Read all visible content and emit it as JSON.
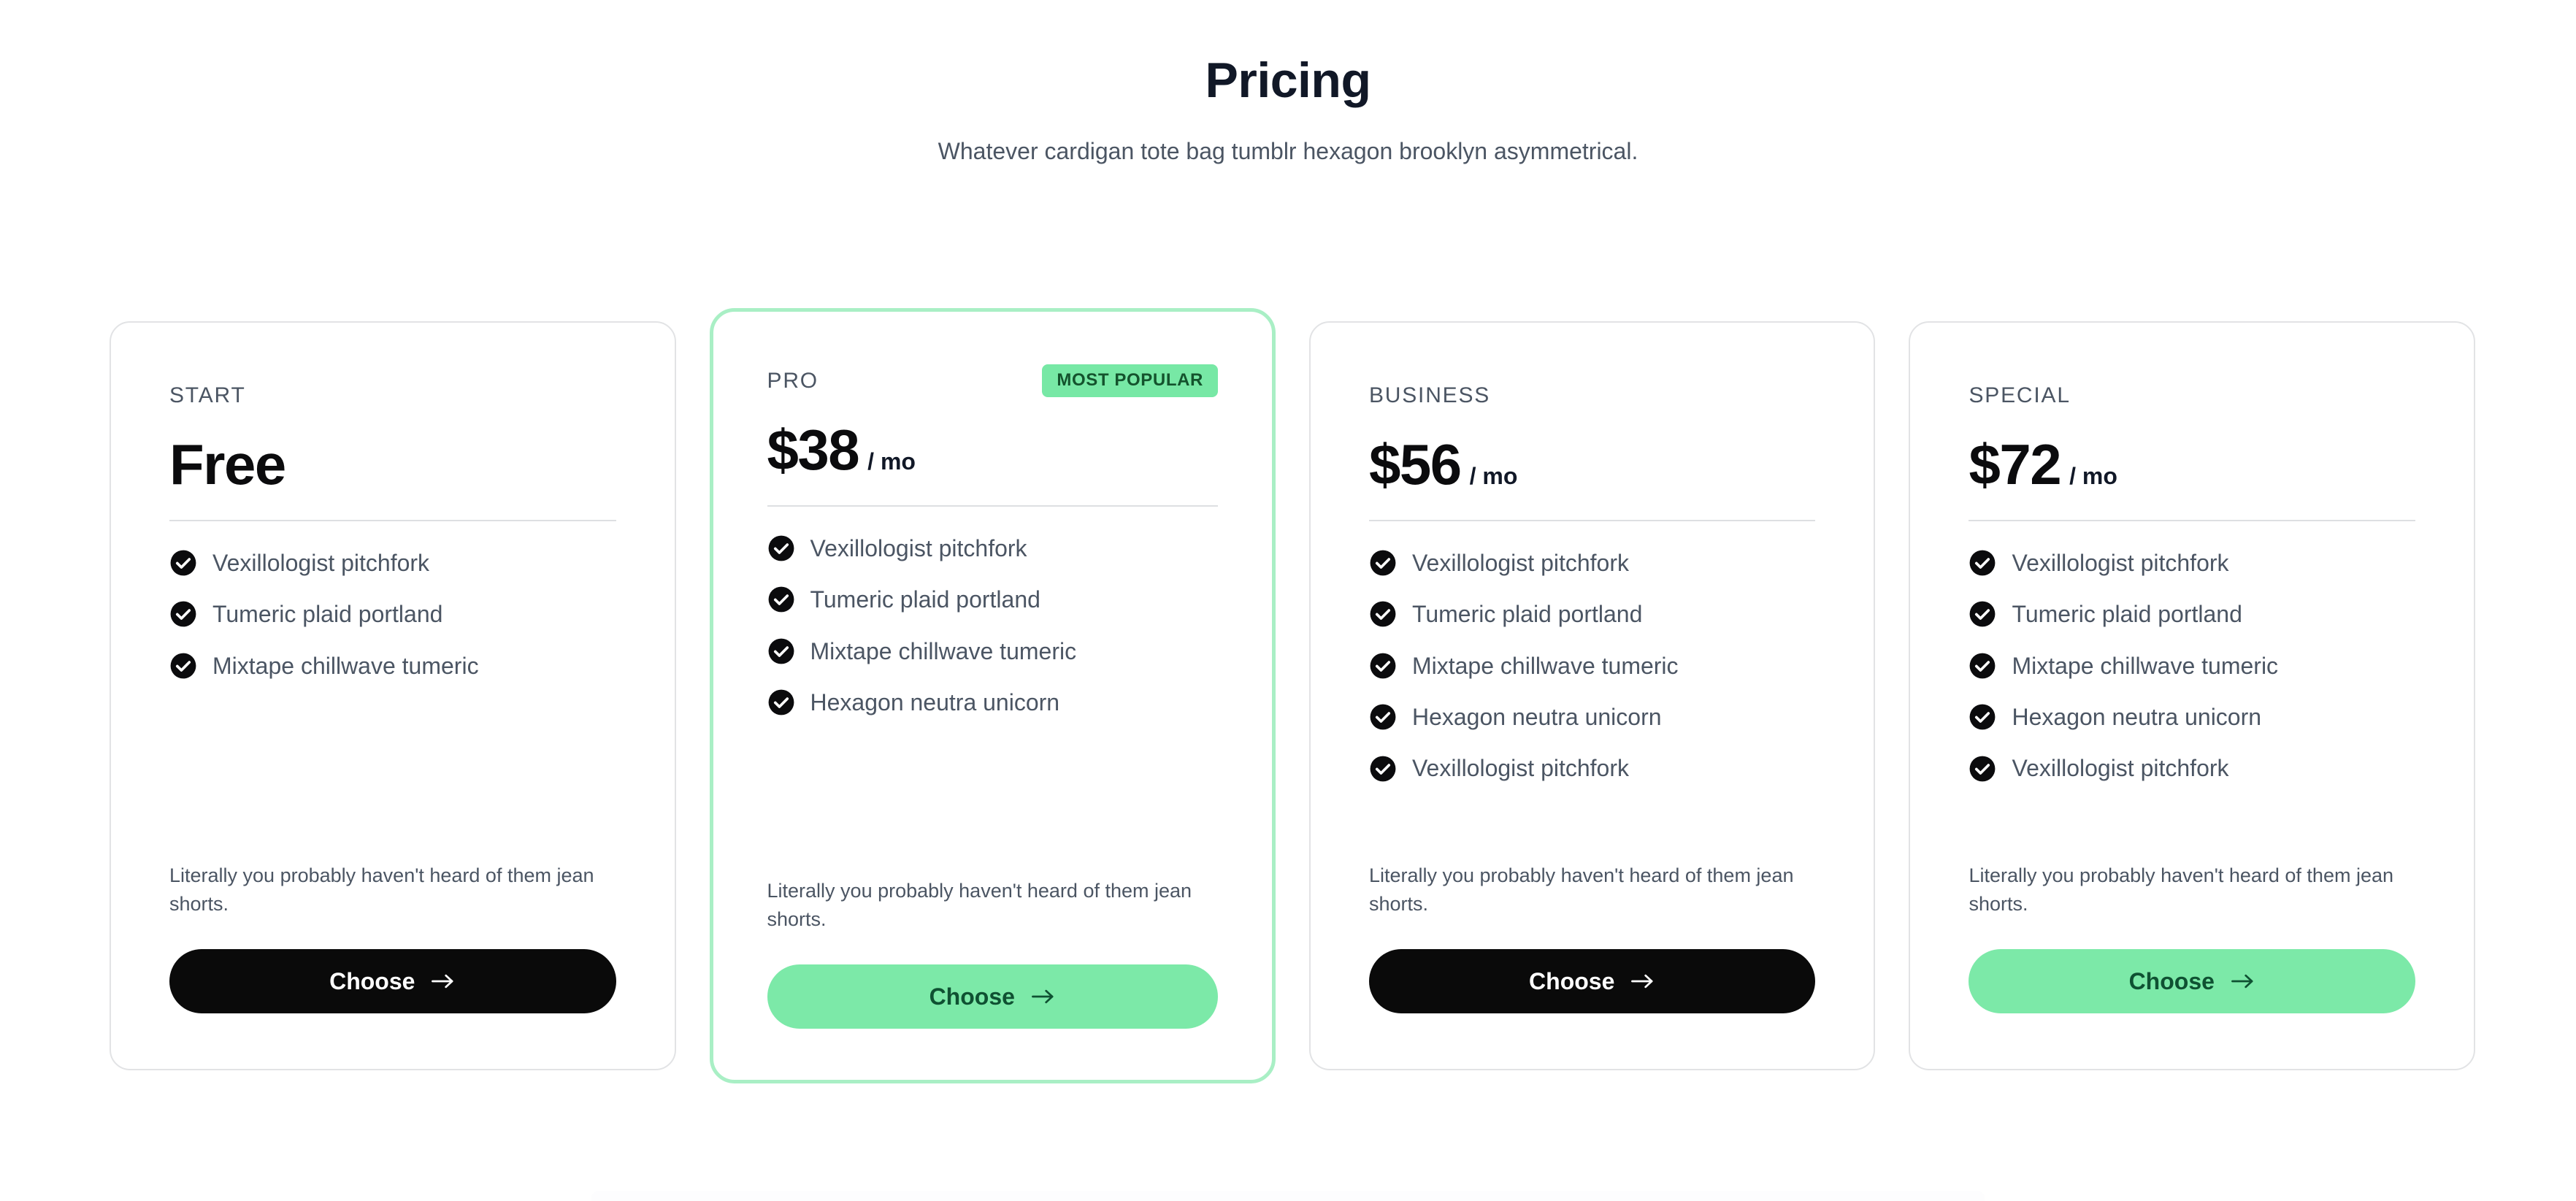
{
  "header": {
    "title": "Pricing",
    "subtitle": "Whatever cardigan tote bag tumblr hexagon brooklyn asymmetrical."
  },
  "colors": {
    "accent_green": "#7ce9a8",
    "badge_bg": "#77e8a5",
    "badge_text": "#14532d",
    "button_dark": "#0a0a0a",
    "button_green_text": "#0f5132",
    "card_border": "#e2e3e5",
    "featured_border": "#a9efc5",
    "text_muted": "#4b5563"
  },
  "common": {
    "note": "Literally you probably haven't heard of them jean shorts.",
    "choose_label": "Choose",
    "check_icon": "check-circle-icon",
    "arrow_icon": "arrow-right-icon"
  },
  "plans": [
    {
      "tier": "START",
      "price": "Free",
      "period": "",
      "badge": "",
      "featured": false,
      "button_style": "dark",
      "features": [
        "Vexillologist pitchfork",
        "Tumeric plaid portland",
        "Mixtape chillwave tumeric"
      ],
      "note": "Literally you probably haven't heard of them jean shorts.",
      "choose_label": "Choose"
    },
    {
      "tier": "PRO",
      "price": "$38",
      "period": "/ mo",
      "badge": "MOST POPULAR",
      "featured": true,
      "button_style": "green",
      "features": [
        "Vexillologist pitchfork",
        "Tumeric plaid portland",
        "Mixtape chillwave tumeric",
        "Hexagon neutra unicorn"
      ],
      "note": "Literally you probably haven't heard of them jean shorts.",
      "choose_label": "Choose"
    },
    {
      "tier": "BUSINESS",
      "price": "$56",
      "period": "/ mo",
      "badge": "",
      "featured": false,
      "button_style": "dark",
      "features": [
        "Vexillologist pitchfork",
        "Tumeric plaid portland",
        "Mixtape chillwave tumeric",
        "Hexagon neutra unicorn",
        "Vexillologist pitchfork"
      ],
      "note": "Literally you probably haven't heard of them jean shorts.",
      "choose_label": "Choose"
    },
    {
      "tier": "SPECIAL",
      "price": "$72",
      "period": "/ mo",
      "badge": "",
      "featured": false,
      "button_style": "green",
      "features": [
        "Vexillologist pitchfork",
        "Tumeric plaid portland",
        "Mixtape chillwave tumeric",
        "Hexagon neutra unicorn",
        "Vexillologist pitchfork"
      ],
      "note": "Literally you probably haven't heard of them jean shorts.",
      "choose_label": "Choose"
    }
  ]
}
